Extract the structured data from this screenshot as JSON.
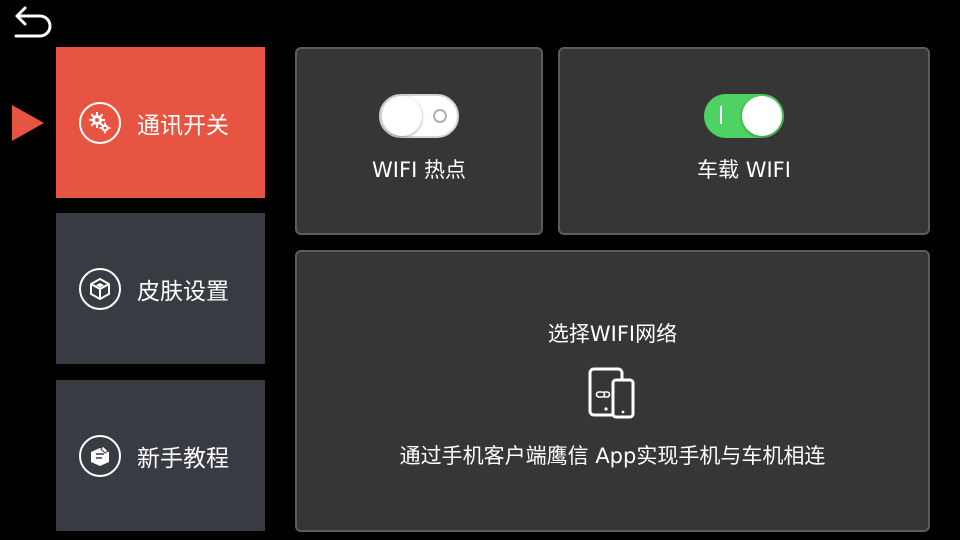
{
  "header": {
    "back_icon": "back-arrow-icon"
  },
  "sidebar": {
    "items": [
      {
        "label": "通讯开关",
        "icon": "gears-icon",
        "active": true
      },
      {
        "label": "皮肤设置",
        "icon": "cube-icon",
        "active": false
      },
      {
        "label": "新手教程",
        "icon": "tutorial-icon",
        "active": false
      }
    ]
  },
  "main": {
    "hotspot": {
      "label": "WIFI 热点",
      "state": "off"
    },
    "car_wifi": {
      "label": "车载 WIFI",
      "state": "on"
    },
    "wifi_network": {
      "title": "选择WIFI网络",
      "icon": "tablet-phone-link-icon",
      "description": "通过手机客户端鹰信 App实现手机与车机相连"
    }
  },
  "colors": {
    "accent": "#e75441",
    "sidebar_inactive": "#393b42",
    "card_bg": "#363636",
    "toggle_on": "#4fd264"
  }
}
